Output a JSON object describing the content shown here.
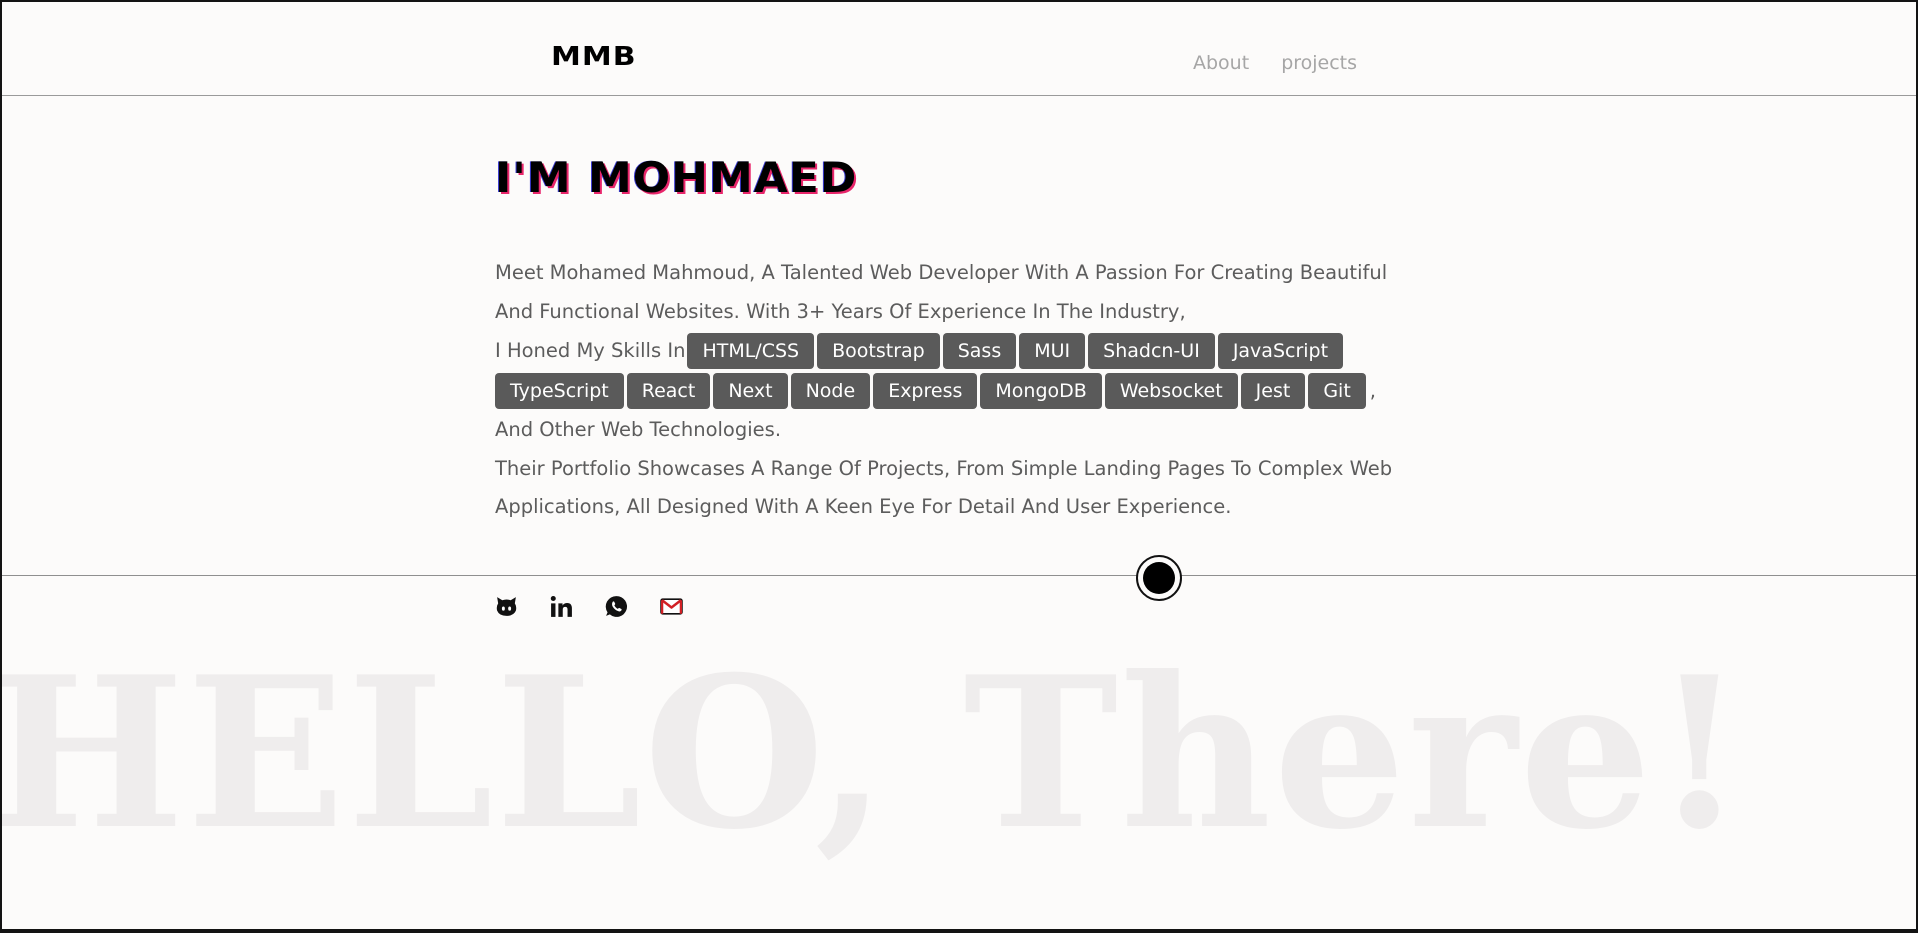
{
  "header": {
    "logo": "MMB",
    "nav": [
      {
        "label": "About"
      },
      {
        "label": "projects"
      }
    ]
  },
  "hero": {
    "title": "I'M MOHMAED",
    "intro_line1": "Meet Mohamed Mahmoud, A Talented Web Developer With A Passion For Creating Beautiful",
    "intro_line2": "And Functional Websites. With 3+ Years Of Experience In The Industry,",
    "skills_lead": "I Honed My Skills In",
    "skills": [
      "HTML/CSS",
      "Bootstrap",
      "Sass",
      "MUI",
      "Shadcn-UI",
      "JavaScript",
      "TypeScript",
      "React",
      "Next",
      "Node",
      "Express",
      "MongoDB",
      "Websocket",
      "Jest",
      "Git"
    ],
    "skills_tail": ",",
    "outro1": "And Other Web Technologies.",
    "outro2": "Their Portfolio Showcases A Range Of Projects, From Simple Landing Pages To Complex Web",
    "outro3": "Applications, All Designed With A Keen Eye For Detail And User Experience."
  },
  "socials": [
    {
      "icon": "github-icon"
    },
    {
      "icon": "linkedin-icon"
    },
    {
      "icon": "whatsapp-icon"
    },
    {
      "icon": "gmail-icon"
    }
  ],
  "background_text": "HELLO, There!"
}
